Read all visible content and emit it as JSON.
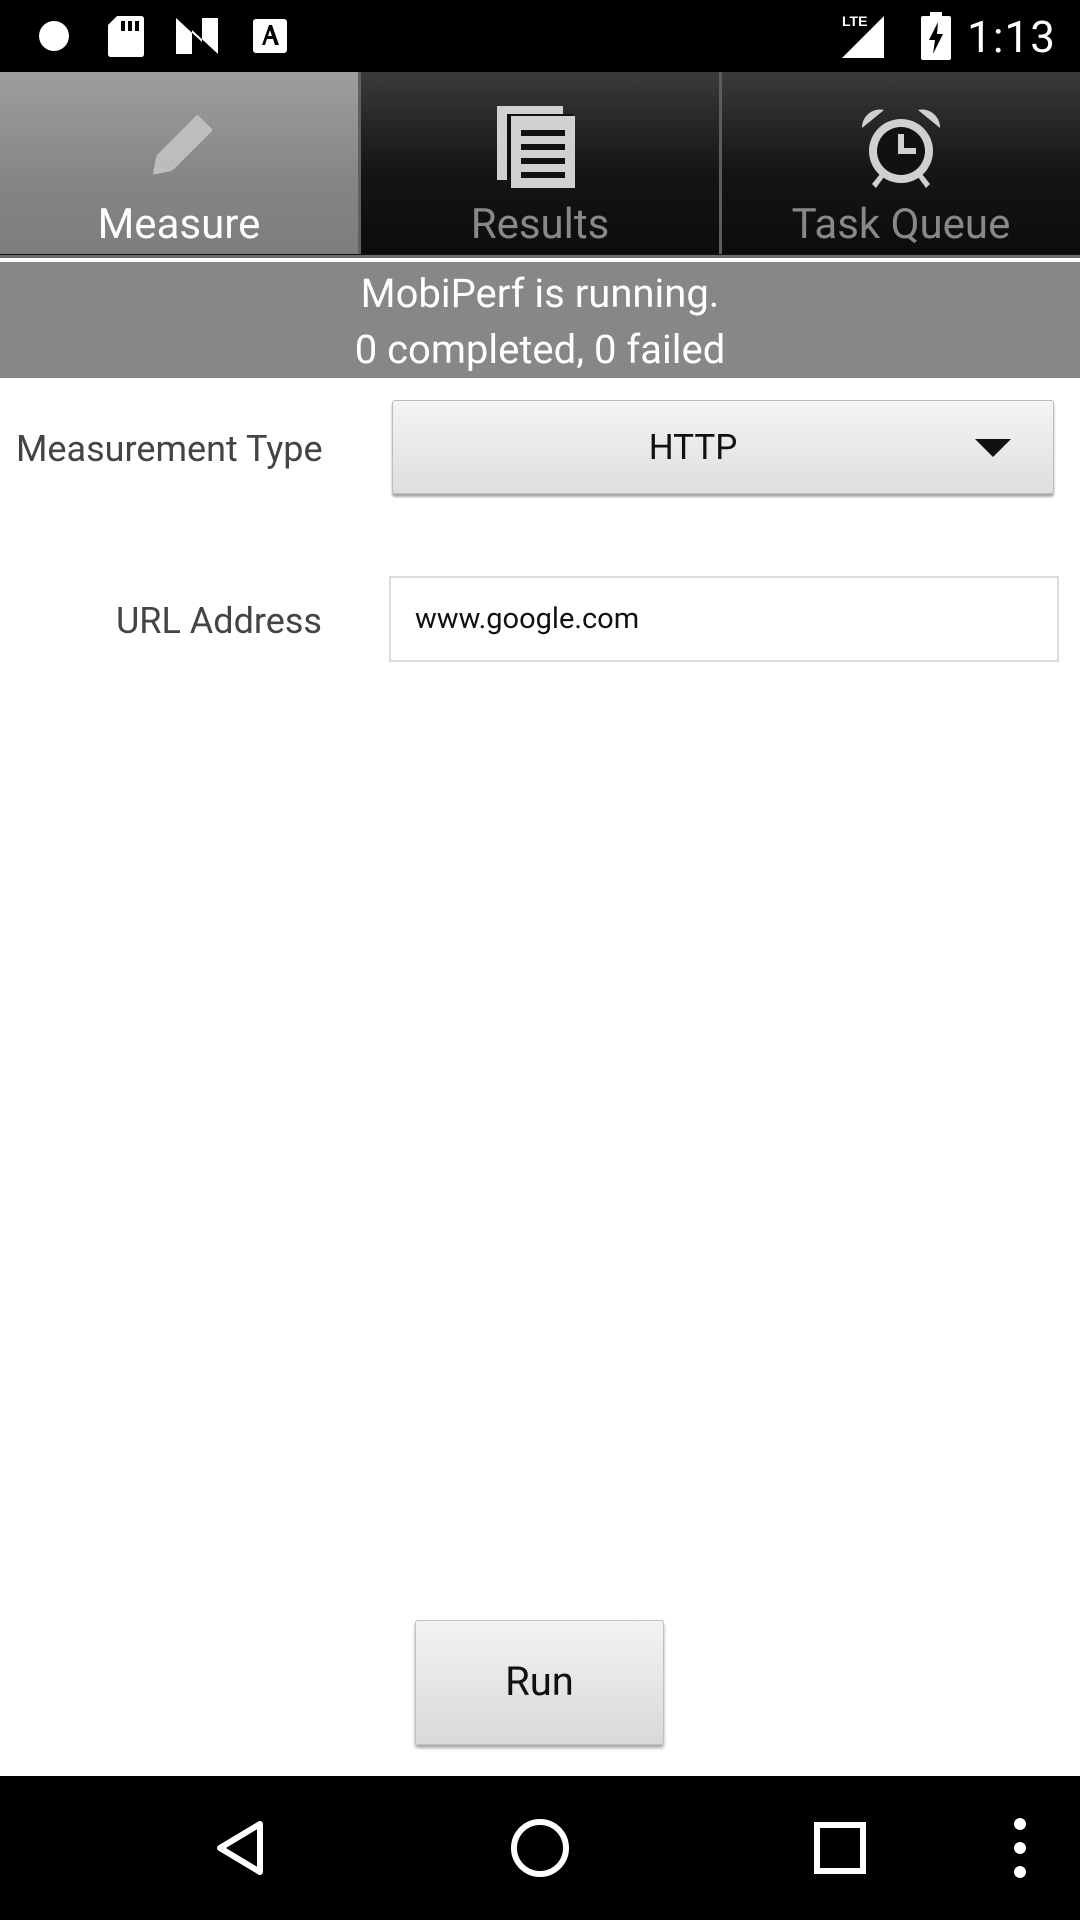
{
  "status_bar": {
    "time": "1:13",
    "network": "LTE",
    "icons": [
      "circle-notification-icon",
      "sd-card-icon",
      "n-notification-icon",
      "a-notification-icon",
      "lte-signal-icon",
      "battery-charging-icon"
    ]
  },
  "tabs": [
    {
      "label": "Measure",
      "icon": "pencil-icon",
      "active": true
    },
    {
      "label": "Results",
      "icon": "document-list-icon",
      "active": false
    },
    {
      "label": "Task Queue",
      "icon": "alarm-clock-icon",
      "active": false
    }
  ],
  "status": {
    "line1": "MobiPerf is running.",
    "line2": "0 completed, 0 failed"
  },
  "form": {
    "measurement_type_label": "Measurement Type",
    "measurement_type_value": "HTTP",
    "url_label": "URL Address",
    "url_value": "www.google.com"
  },
  "run_label": "Run",
  "navigation": [
    "back-icon",
    "home-icon",
    "recents-icon",
    "overflow-menu-icon"
  ]
}
